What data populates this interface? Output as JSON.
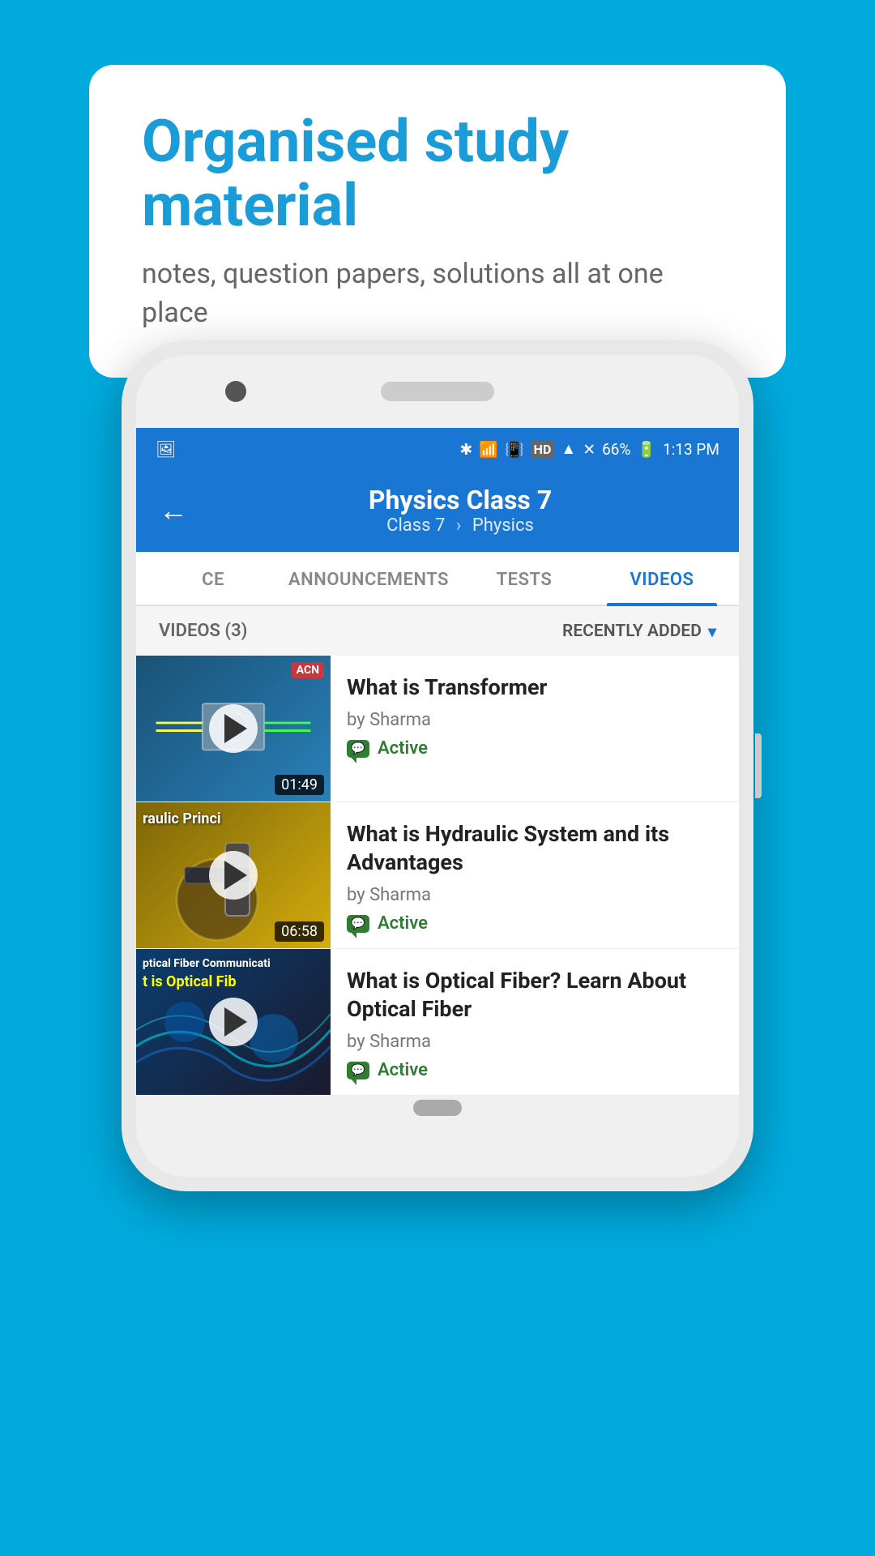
{
  "background_color": "#00aadd",
  "speech_bubble": {
    "title": "Organised study material",
    "subtitle": "notes, question papers, solutions all at one place"
  },
  "status_bar": {
    "battery": "66%",
    "time": "1:13 PM",
    "hd_label": "HD"
  },
  "app_header": {
    "title": "Physics Class 7",
    "breadcrumb_class": "Class 7",
    "breadcrumb_subject": "Physics"
  },
  "tabs": [
    {
      "label": "CE",
      "active": false
    },
    {
      "label": "ANNOUNCEMENTS",
      "active": false
    },
    {
      "label": "TESTS",
      "active": false
    },
    {
      "label": "VIDEOS",
      "active": true
    }
  ],
  "filter_bar": {
    "count_label": "VIDEOS (3)",
    "sort_label": "RECENTLY ADDED"
  },
  "videos": [
    {
      "title": "What is  Transformer",
      "author": "by Sharma",
      "status": "Active",
      "duration": "01:49",
      "thumbnail_type": "transformer",
      "thumbnail_top_label": "ACN"
    },
    {
      "title": "What is Hydraulic System and its Advantages",
      "author": "by Sharma",
      "status": "Active",
      "duration": "06:58",
      "thumbnail_type": "hydraulic",
      "thumbnail_text": "raulic Princi"
    },
    {
      "title": "What is Optical Fiber? Learn About Optical Fiber",
      "author": "by Sharma",
      "status": "Active",
      "duration": "",
      "thumbnail_type": "optical",
      "thumbnail_line1": "ptical Fiber Communicati",
      "thumbnail_line2": "t is Optical Fib"
    }
  ],
  "icons": {
    "back_arrow": "←",
    "chevron_down": "▾",
    "play": "▶"
  }
}
